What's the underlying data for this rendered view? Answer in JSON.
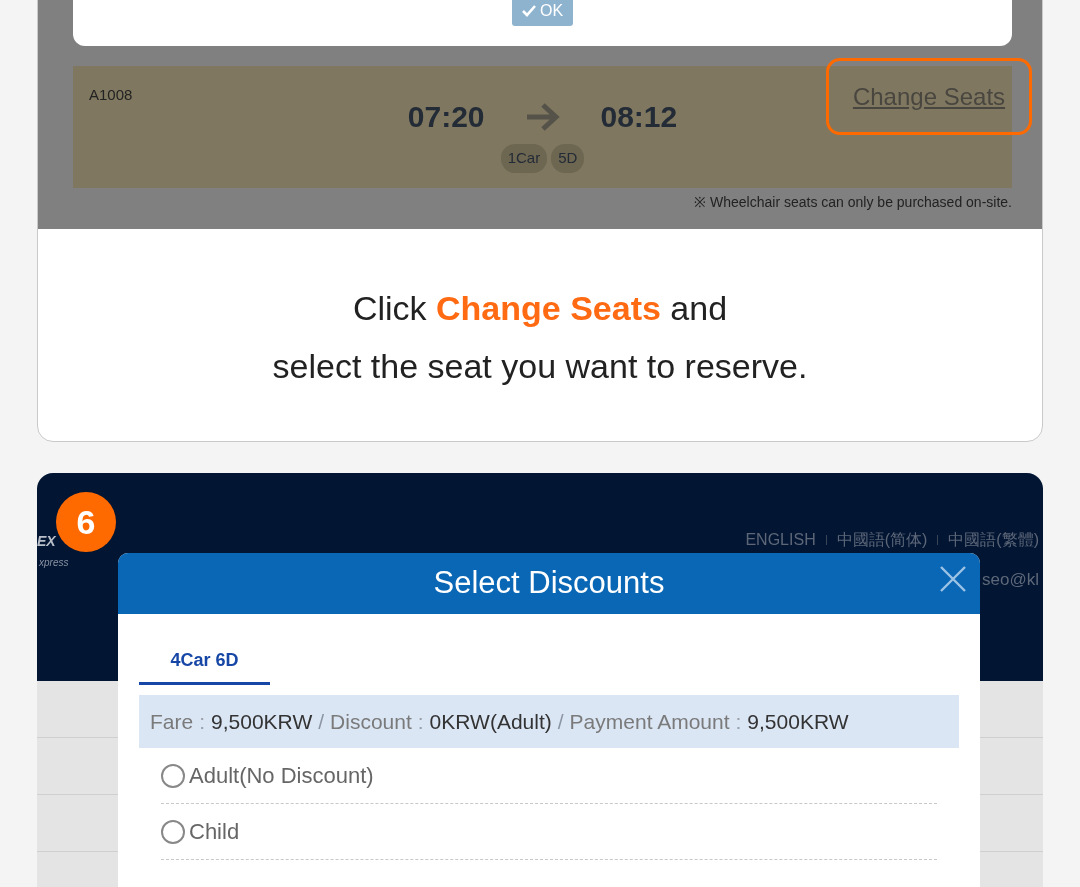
{
  "step_card_1": {
    "dialog_button": "OK",
    "train": {
      "number": "A1008",
      "depart": "07:20",
      "arrive": "08:12",
      "tags": [
        "1Car",
        "5D"
      ]
    },
    "change_seats": {
      "label": "Change Seats",
      "highlighted": true
    },
    "note": "※ Wheelchair seats can only be purchased on-site.",
    "caption": [
      "Click **Change Seats** and",
      "select the seat you want to reserve."
    ]
  },
  "step_card_2": {
    "step_number": "6",
    "logo": [
      "EX",
      "xpress"
    ],
    "languages": [
      "ENGLISH",
      "中國語(简体)",
      "中國語(繁體)"
    ],
    "user_email": "seo@kl",
    "dialog": {
      "title": "Select Discounts",
      "tabs": [
        {
          "label": "4Car 6D",
          "selected": true
        }
      ],
      "fare_summary": {
        "colon": ":",
        "separator": "/",
        "items": [
          {
            "label": "Fare",
            "value": "9,500KRW"
          },
          {
            "label": "Discount",
            "value": "0KRW(Adult)"
          },
          {
            "label": "Payment Amount",
            "value": "9,500KRW"
          }
        ]
      },
      "options": [
        {
          "label": "Adult(No Discount)",
          "selected": false
        },
        {
          "label": "Child",
          "selected": false
        }
      ]
    }
  }
}
